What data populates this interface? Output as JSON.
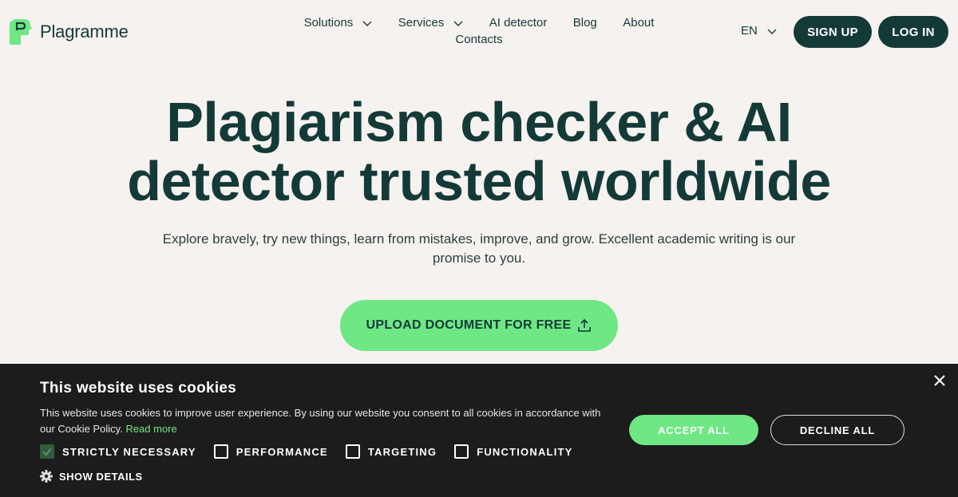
{
  "header": {
    "brand": "Plagramme",
    "nav": [
      {
        "label": "Solutions",
        "dropdown": true
      },
      {
        "label": "Services",
        "dropdown": true
      },
      {
        "label": "AI detector",
        "dropdown": false
      },
      {
        "label": "Blog",
        "dropdown": false
      },
      {
        "label": "About",
        "dropdown": false
      },
      {
        "label": "Contacts",
        "dropdown": false
      }
    ],
    "language": "EN",
    "signup_label": "SIGN UP",
    "login_label": "LOG IN"
  },
  "hero": {
    "title_line1": "Plagiarism checker & AI",
    "title_line2": "detector trusted worldwide",
    "subtitle": "Explore bravely, try new things, learn from mistakes, improve, and grow. Excellent academic writing is our promise to you.",
    "upload_label": "UPLOAD DOCUMENT FOR FREE"
  },
  "cookie_banner": {
    "title": "This website uses cookies",
    "text": "This website uses cookies to improve user experience. By using our website you consent to all cookies in accordance with our Cookie Policy.",
    "read_more": "Read more",
    "options": [
      {
        "label": "STRICTLY NECESSARY",
        "checked": true
      },
      {
        "label": "PERFORMANCE",
        "checked": false
      },
      {
        "label": "TARGETING",
        "checked": false
      },
      {
        "label": "FUNCTIONALITY",
        "checked": false
      }
    ],
    "show_details": "SHOW DETAILS",
    "accept_label": "ACCEPT ALL",
    "decline_label": "DECLINE ALL"
  },
  "colors": {
    "brand_dark": "#143a38",
    "brand_green": "#6ee784",
    "background": "#f6f2ef",
    "banner_bg": "#1c1c1c"
  }
}
